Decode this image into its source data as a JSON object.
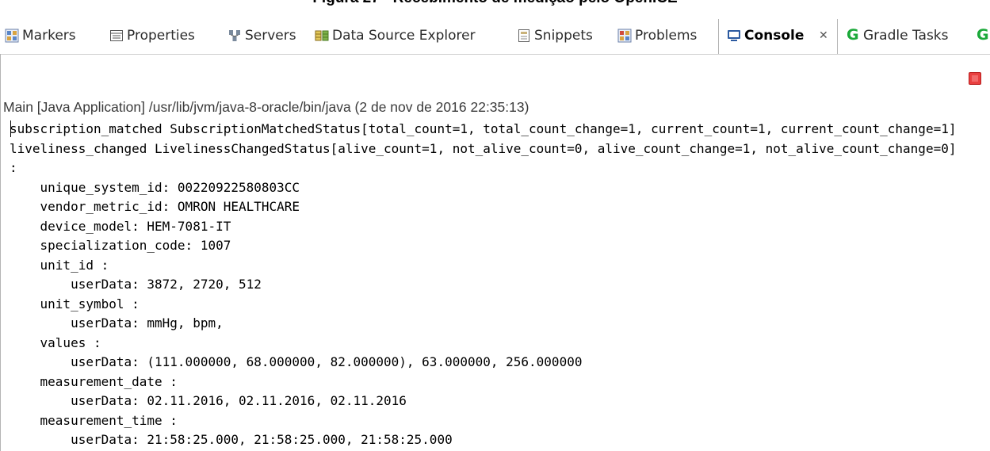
{
  "caption": "Figura 27 - Recebimento de medição pelo OpenICE",
  "tabs": [
    {
      "id": "markers",
      "label": "Markers",
      "icon": "markers-icon",
      "active": false
    },
    {
      "id": "properties",
      "label": "Properties",
      "icon": "properties-icon",
      "active": false
    },
    {
      "id": "servers",
      "label": "Servers",
      "icon": "servers-icon",
      "active": false
    },
    {
      "id": "data-source-explorer",
      "label": "Data Source Explorer",
      "icon": "database-icon",
      "active": false
    },
    {
      "id": "snippets",
      "label": "Snippets",
      "icon": "snippets-icon",
      "active": false
    },
    {
      "id": "problems",
      "label": "Problems",
      "icon": "problems-icon",
      "active": false
    },
    {
      "id": "console",
      "label": "Console",
      "icon": "console-icon",
      "active": true,
      "close_glyph": "✕"
    },
    {
      "id": "gradle-tasks",
      "label": "Gradle Tasks",
      "icon": "gradle-icon",
      "active": false
    },
    {
      "id": "gradle-extra",
      "label": "",
      "icon": "gradle-icon",
      "active": false
    }
  ],
  "console": {
    "process_label": "Main [Java Application] /usr/lib/jvm/java-8-oracle/bin/java (2 de nov de 2016 22:35:13)",
    "lines": [
      "subscription_matched SubscriptionMatchedStatus[total_count=1, total_count_change=1, current_count=1, current_count_change=1]",
      "liveliness_changed LivelinessChangedStatus[alive_count=1, not_alive_count=0, alive_count_change=1, not_alive_count_change=0]",
      ":",
      "    unique_system_id: 00220922580803CC",
      "    vendor_metric_id: OMRON HEALTHCARE",
      "    device_model: HEM-7081-IT",
      "    specialization_code: 1007",
      "    unit_id :",
      "        userData: 3872, 2720, 512",
      "    unit_symbol :",
      "        userData: mmHg, bpm,",
      "    values :",
      "        userData: (111.000000, 68.000000, 82.000000), 63.000000, 256.000000",
      "    measurement_date :",
      "        userData: 02.11.2016, 02.11.2016, 02.11.2016",
      "    measurement_time :",
      "        userData: 21:58:25.000, 21:58:25.000, 21:58:25.000"
    ]
  },
  "colors": {
    "stop": "#e94040",
    "gradle_green": "#1ba93a",
    "border": "#b4b4b4"
  }
}
